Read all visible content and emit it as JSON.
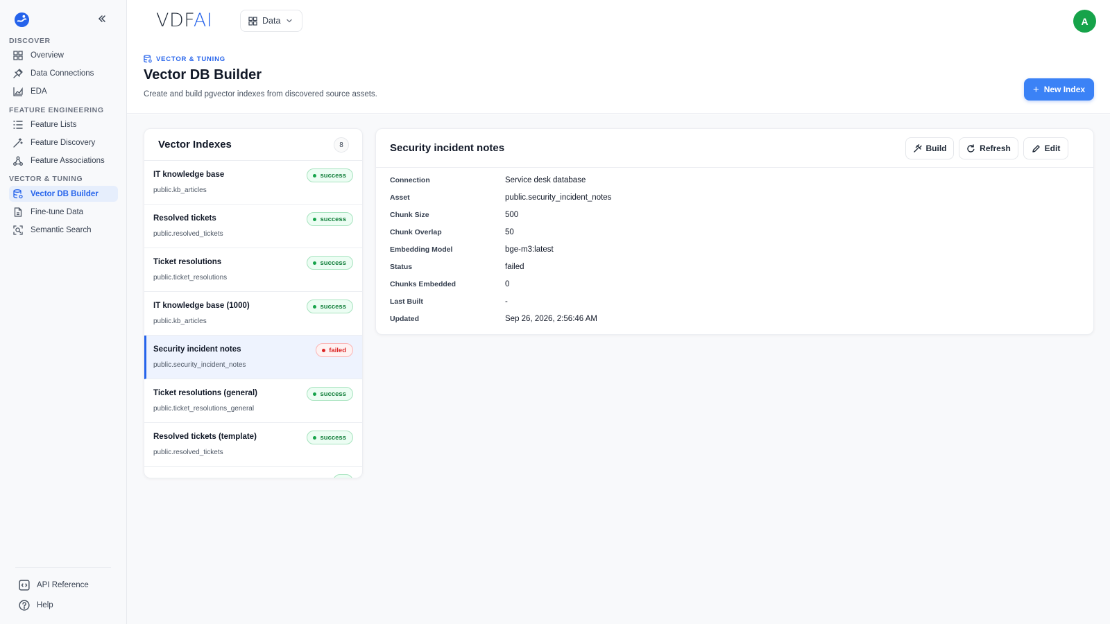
{
  "sidebar": {
    "sections": [
      {
        "title": "DISCOVER",
        "items": [
          {
            "label": "Overview",
            "icon": "dashboard-grid-icon"
          },
          {
            "label": "Data Connections",
            "icon": "plug-icon"
          },
          {
            "label": "EDA",
            "icon": "area-chart-icon"
          }
        ]
      },
      {
        "title": "FEATURE ENGINEERING",
        "items": [
          {
            "label": "Feature Lists",
            "icon": "list-icon"
          },
          {
            "label": "Feature Discovery",
            "icon": "magic-wand-icon"
          },
          {
            "label": "Feature Associations",
            "icon": "network-icon"
          }
        ]
      },
      {
        "title": "VECTOR & TUNING",
        "items": [
          {
            "label": "Vector DB Builder",
            "icon": "database-icon",
            "active": true
          },
          {
            "label": "Fine-tune Data",
            "icon": "file-icon"
          },
          {
            "label": "Semantic Search",
            "icon": "search-scan-icon"
          }
        ]
      }
    ],
    "footer": [
      {
        "label": "API Reference",
        "icon": "code-icon"
      },
      {
        "label": "Help",
        "icon": "help-circle-icon"
      }
    ]
  },
  "header": {
    "brand_main": "VDF",
    "brand_accent": "AI",
    "menu_label": "Data",
    "avatar_initial": "A"
  },
  "page": {
    "breadcrumb": "VECTOR & TUNING",
    "title": "Vector DB Builder",
    "subtitle": "Create and build pgvector indexes from discovered source assets.",
    "new_button": "New Index"
  },
  "index_list": {
    "title": "Vector Indexes",
    "count": "8",
    "items": [
      {
        "name": "IT knowledge base",
        "asset": "public.kb_articles",
        "status": "success"
      },
      {
        "name": "Resolved tickets",
        "asset": "public.resolved_tickets",
        "status": "success"
      },
      {
        "name": "Ticket resolutions",
        "asset": "public.ticket_resolutions",
        "status": "success"
      },
      {
        "name": "IT knowledge base (1000)",
        "asset": "public.kb_articles",
        "status": "success"
      },
      {
        "name": "Security incident notes",
        "asset": "public.security_incident_notes",
        "status": "failed",
        "selected": true
      },
      {
        "name": "Ticket resolutions (general)",
        "asset": "public.ticket_resolutions_general",
        "status": "success"
      },
      {
        "name": "Resolved tickets (template)",
        "asset": "public.resolved_tickets",
        "status": "success"
      }
    ]
  },
  "detail": {
    "title": "Security incident notes",
    "buttons": {
      "build": "Build",
      "refresh": "Refresh",
      "edit": "Edit"
    },
    "fields": [
      {
        "label": "Connection",
        "value": "Service desk database"
      },
      {
        "label": "Asset",
        "value": "public.security_incident_notes"
      },
      {
        "label": "Chunk Size",
        "value": "500"
      },
      {
        "label": "Chunk Overlap",
        "value": "50"
      },
      {
        "label": "Embedding Model",
        "value": "bge-m3:latest"
      },
      {
        "label": "Status",
        "value": "failed"
      },
      {
        "label": "Chunks Embedded",
        "value": "0"
      },
      {
        "label": "Last Built",
        "value": "-"
      },
      {
        "label": "Updated",
        "value": "Sep 26, 2026, 2:56:46 AM"
      }
    ]
  },
  "colors": {
    "accent": "#2563eb",
    "success": "#16a34a",
    "failed": "#dc2626",
    "avatar": "#16a34a"
  }
}
